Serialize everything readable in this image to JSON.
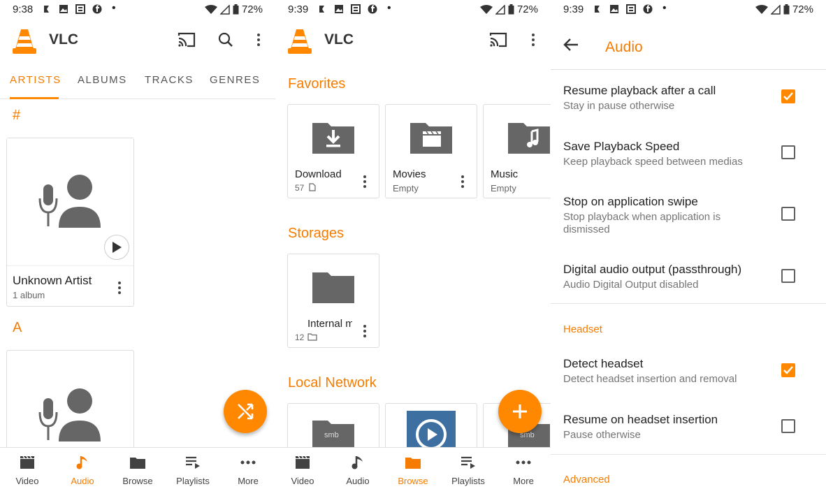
{
  "colors": {
    "accent": "#ff8800",
    "accent_text": "#f57c00"
  },
  "panels": [
    {
      "status": {
        "time": "9:38",
        "battery": "72%"
      },
      "app_title": "VLC",
      "tabs": [
        "ARTISTS",
        "ALBUMS",
        "TRACKS",
        "GENRES"
      ],
      "sections": [
        "#",
        "A"
      ],
      "artist_card": {
        "name": "Unknown Artist",
        "sub": "1 album"
      },
      "fab_icon": "shuffle-icon",
      "nav": [
        "Video",
        "Audio",
        "Browse",
        "Playlists",
        "More"
      ],
      "active_nav": "Audio"
    },
    {
      "status": {
        "time": "9:39",
        "battery": "72%"
      },
      "app_title": "VLC",
      "sections": {
        "favorites": "Favorites",
        "storages": "Storages",
        "local_network": "Local Network"
      },
      "favorites": [
        {
          "name": "Download",
          "sub": "57"
        },
        {
          "name": "Movies",
          "sub": "Empty"
        },
        {
          "name": "Music",
          "sub": "Empty"
        }
      ],
      "storages": [
        {
          "name": "Internal m",
          "sub": "12"
        }
      ],
      "network": [
        {
          "label": "smb"
        },
        {
          "label": ""
        },
        {
          "label": "smb"
        }
      ],
      "fab_icon": "plus-icon",
      "nav": [
        "Video",
        "Audio",
        "Browse",
        "Playlists",
        "More"
      ],
      "active_nav": "Browse"
    },
    {
      "status": {
        "time": "9:39",
        "battery": "72%"
      },
      "title": "Audio",
      "settings": [
        {
          "title": "Resume playback after a call",
          "sub": "Stay in pause otherwise",
          "checked": true
        },
        {
          "title": "Save Playback Speed",
          "sub": "Keep playback speed between medias",
          "checked": false
        },
        {
          "title": "Stop on application swipe",
          "sub": "Stop playback when application is dismissed",
          "checked": false
        },
        {
          "title": "Digital audio output (passthrough)",
          "sub": "Audio Digital Output disabled",
          "checked": false
        }
      ],
      "headset_header": "Headset",
      "headset": [
        {
          "title": "Detect headset",
          "sub": "Detect headset insertion and removal",
          "checked": true
        },
        {
          "title": "Resume on headset insertion",
          "sub": "Pause otherwise",
          "checked": false
        }
      ],
      "advanced_header": "Advanced"
    }
  ]
}
